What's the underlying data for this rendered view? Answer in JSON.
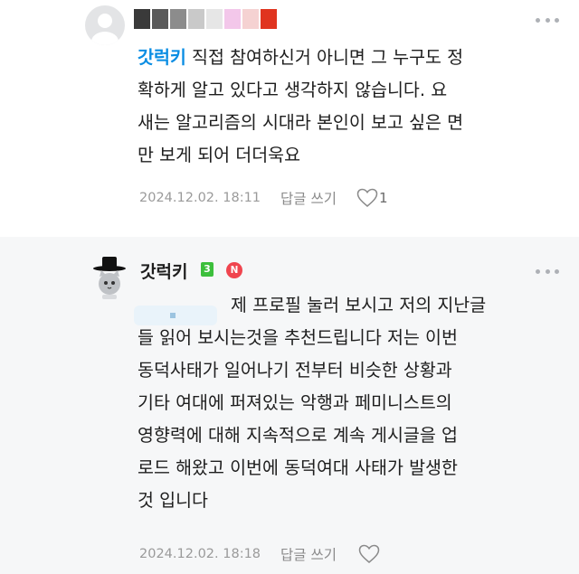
{
  "comment1": {
    "mention": "갓럭키",
    "text": " 직접 참여하신거 아니면 그 누구도 정\n확하게 알고 있다고 생각하지 않습니다. 요\n새는 알고리즘의 시대라 본인이 보고 싶은 면\n만 보게 되어 더더욱요",
    "timestamp": "2024.12.02. 18:11",
    "reply_label": "답글 쓰기",
    "likes": "1"
  },
  "comment2": {
    "author": "갓럭키",
    "level": "3",
    "badge": "N",
    "text": "제 프로필 눌러 보시고 저의 지난글\n들 읽어 보시는것을 추천드립니다 저는 이번\n동덕사태가 일어나기 전부터 비슷한 상황과\n기타 여대에 퍼져있는 악행과 페미니스트의\n영향력에 대해 지속적으로 계속 게시글을 업\n로드 해왔고 이번에 동덕여대 사태가 발생한\n것 입니다",
    "timestamp": "2024.12.02. 18:18",
    "reply_label": "답글 쓰기"
  },
  "colors": {
    "mention": "#0a8de3",
    "level_badge": "#3cbf3c",
    "n_badge": "#f0454f",
    "reply_bg": "#f6f7f8"
  },
  "icons": [
    "default-avatar-icon",
    "more-options-icon",
    "heart-icon",
    "cat-hat-avatar"
  ]
}
